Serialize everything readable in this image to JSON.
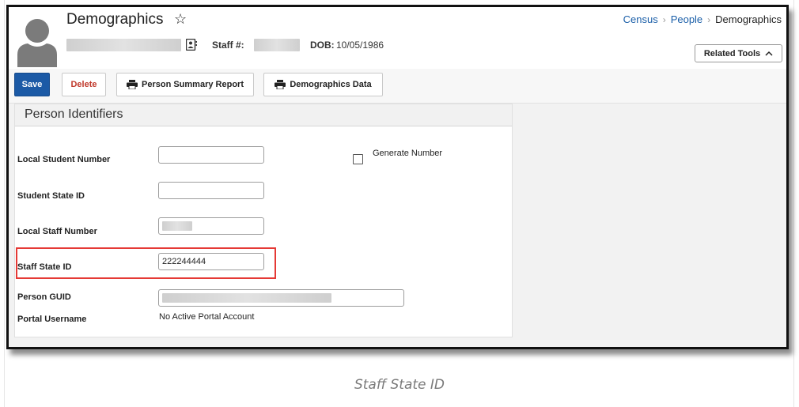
{
  "header": {
    "title": "Demographics",
    "staff_label": "Staff #:",
    "dob_label": "DOB:",
    "dob_value": "10/05/1986",
    "breadcrumb": [
      "Census",
      "People",
      "Demographics"
    ],
    "related_tools": "Related Tools"
  },
  "toolbar": {
    "save": "Save",
    "delete": "Delete",
    "person_summary": "Person Summary Report",
    "demographics_data": "Demographics Data"
  },
  "panel": {
    "title": "Person Identifiers",
    "fields": {
      "local_student_number": {
        "label": "Local Student Number",
        "value": ""
      },
      "generate_number": "Generate Number",
      "student_state_id": {
        "label": "Student State ID",
        "value": ""
      },
      "local_staff_number": {
        "label": "Local Staff Number"
      },
      "staff_state_id": {
        "label": "Staff State ID",
        "value": "222244444"
      },
      "person_guid": {
        "label": "Person GUID"
      },
      "portal_username": {
        "label": "Portal Username",
        "value": "No Active Portal Account"
      }
    }
  },
  "caption": "Staff State ID",
  "colors": {
    "accent": "#1c5aa6",
    "delete": "#c0392b",
    "highlight": "#e53935"
  }
}
